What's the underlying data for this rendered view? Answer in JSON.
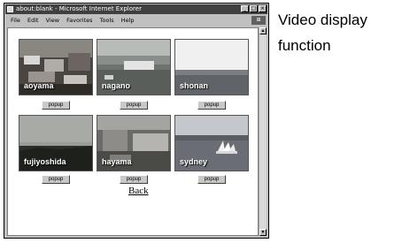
{
  "window": {
    "title": "about:blank - Microsoft Internet Explorer",
    "menu": [
      "File",
      "Edit",
      "View",
      "Favorites",
      "Tools",
      "Help"
    ]
  },
  "thumbnails": [
    {
      "label": "aoyama",
      "button": "popup"
    },
    {
      "label": "nagano",
      "button": "popup"
    },
    {
      "label": "shonan",
      "button": "popup"
    },
    {
      "label": "fujiyoshida",
      "button": "popup"
    },
    {
      "label": "hayama",
      "button": "popup"
    },
    {
      "label": "sydney",
      "button": "popup"
    }
  ],
  "back_link": "Back",
  "caption": {
    "line1": "Video display",
    "line2": "function"
  }
}
